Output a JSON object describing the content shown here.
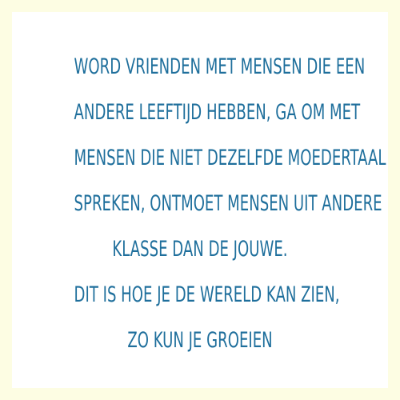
{
  "quote": {
    "lines": [
      "WORD VRIENDEN MET MENSEN DIE EEN",
      "ANDERE LEEFTIJD HEBBEN, GA OM MET",
      "MENSEN DIE NIET DEZELFDE MOEDERTAAL",
      "SPREKEN, ONTMOET MENSEN  UIT ANDERE",
      "KLASSE DAN DE JOUWE.",
      " DIT IS HOE JE DE WERELD KAN ZIEN,",
      "ZO KUN JE GROEIEN"
    ],
    "text_color": "#1f6f9c"
  },
  "colors": {
    "border": "#fdfde3",
    "background": "#ffffff"
  }
}
